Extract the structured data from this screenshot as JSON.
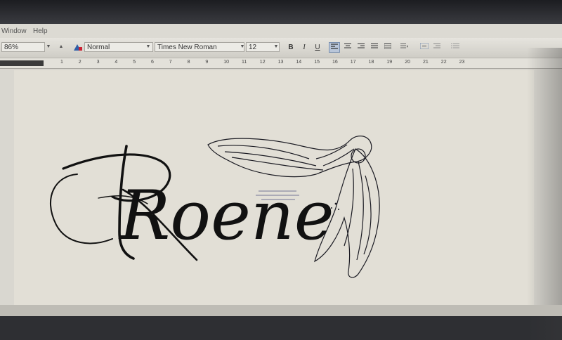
{
  "menu": {
    "items": [
      {
        "label": "Window"
      },
      {
        "label": "Help"
      }
    ]
  },
  "toolbar": {
    "zoom": "86%",
    "style": "Normal",
    "font": "Times New Roman",
    "size": "12",
    "bold_label": "B",
    "italic_label": "I",
    "underline_label": "U",
    "align_left_active": true,
    "icons": [
      "styles-icon",
      "bold-icon",
      "italic-icon",
      "underline-icon",
      "align-left-icon",
      "align-center-icon",
      "align-right-icon",
      "justify-icon",
      "line-spacing-icon",
      "indent-icon",
      "outdent-icon",
      "list-icon"
    ]
  },
  "ruler": {
    "ticks": [
      "1",
      "2",
      "3",
      "4",
      "5",
      "6",
      "7",
      "8",
      "9",
      "10",
      "11",
      "12",
      "13",
      "14",
      "15",
      "16",
      "17",
      "18",
      "19",
      "20",
      "21",
      "22",
      "23"
    ]
  },
  "document": {
    "script_text": "Roene",
    "logo": "angel-wings-icon"
  },
  "colors": {
    "ink": "#111111",
    "paper": "#e2dfd6",
    "toolbar": "#dcdad3"
  }
}
